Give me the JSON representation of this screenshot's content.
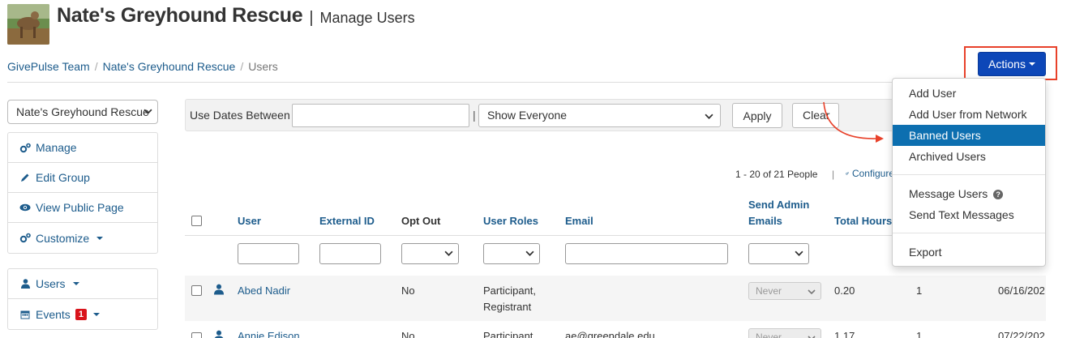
{
  "header": {
    "org_name": "Nate's Greyhound Rescue",
    "separator": "|",
    "page_title": "Manage Users"
  },
  "breadcrumb": {
    "items": [
      "GivePulse Team",
      "Nate's Greyhound Rescue"
    ],
    "separator": "/",
    "current": "Users"
  },
  "actions": {
    "label": "Actions",
    "menu": {
      "add_user": "Add User",
      "add_user_network": "Add User from Network",
      "banned_users": "Banned Users",
      "archived_users": "Archived Users",
      "message_users": "Message Users",
      "send_text": "Send Text Messages",
      "export": "Export"
    }
  },
  "sidebar": {
    "group_select": "Nate's Greyhound Rescue",
    "panel1": [
      {
        "label": "Manage",
        "icon": "gears-icon"
      },
      {
        "label": "Edit Group",
        "icon": "pencil-icon"
      },
      {
        "label": "View Public Page",
        "icon": "eye-icon"
      },
      {
        "label": "Customize",
        "icon": "gears-icon"
      }
    ],
    "panel2": [
      {
        "label": "Users",
        "icon": "user-icon"
      },
      {
        "label": "Events",
        "icon": "calendar-icon",
        "badge": "1"
      }
    ]
  },
  "filter": {
    "label": "Use Dates Between",
    "separator": "|",
    "date_value": "",
    "show_select": "Show Everyone",
    "apply": "Apply",
    "clear": "Clear"
  },
  "pagination": {
    "count_text": "1 - 20 of 21 People",
    "separator": "|",
    "configure": "Configure"
  },
  "table": {
    "headers": {
      "user": "User",
      "external_id": "External ID",
      "opt_out": "Opt Out",
      "user_roles": "User Roles",
      "email": "Email",
      "send_admin_1": "Send Admin",
      "send_admin_2": "Emails",
      "total_hours": "Total Hours"
    },
    "rows": [
      {
        "name": "Abed Nadir",
        "opt_out": "No",
        "roles_1": "Participant,",
        "roles_2": "Registrant",
        "email": "",
        "send_admin": "Never",
        "hours": "0.20",
        "count": "1",
        "date": "06/16/202"
      },
      {
        "name": "Annie Edison",
        "opt_out": "No",
        "roles_1": "Participant",
        "roles_2": "",
        "email": "ae@greendale.edu",
        "send_admin": "Never",
        "hours": "1.17",
        "count": "1",
        "date": "07/22/202"
      }
    ]
  },
  "colors": {
    "accent": "#0d47b8",
    "link": "#1d5c8c",
    "highlight": "#e8412a",
    "menu_active": "#0d6fb0",
    "badge": "#d9141b"
  }
}
